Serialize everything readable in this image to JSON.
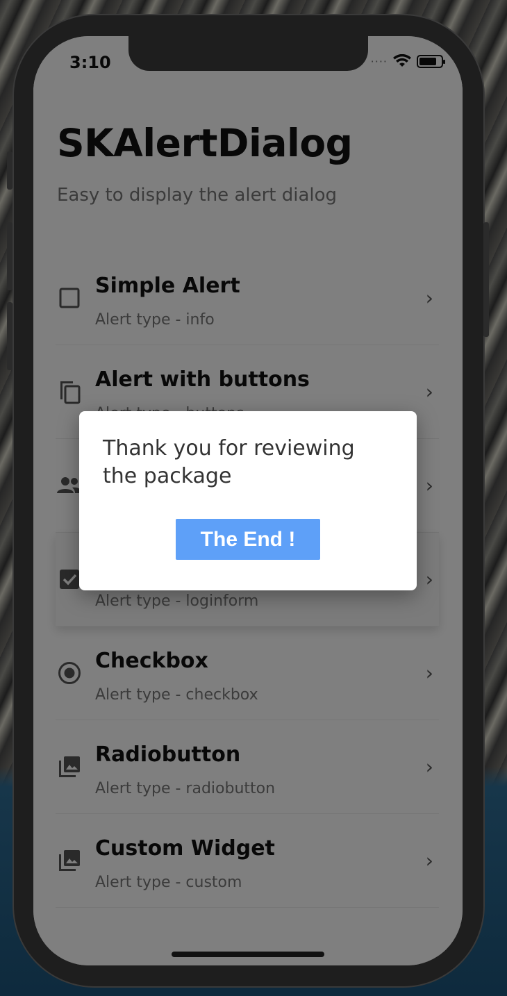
{
  "status_bar": {
    "time": "3:10"
  },
  "app": {
    "title": "SKAlertDialog",
    "subtitle": "Easy to display the alert dialog"
  },
  "list": {
    "items": [
      {
        "title": "Simple Alert",
        "subtitle": "Alert type - info",
        "icon": "square-outline-icon"
      },
      {
        "title": "Alert with buttons",
        "subtitle": "Alert type - buttons",
        "icon": "copy-icon"
      },
      {
        "title": "",
        "subtitle": "",
        "icon": "people-icon"
      },
      {
        "title": "",
        "subtitle": "Alert type - loginform",
        "icon": "checkbox-checked-icon"
      },
      {
        "title": "Checkbox",
        "subtitle": "Alert type - checkbox",
        "icon": "radio-checked-icon"
      },
      {
        "title": "Radiobutton",
        "subtitle": "Alert type - radiobutton",
        "icon": "photo-library-icon"
      },
      {
        "title": "Custom Widget",
        "subtitle": "Alert type - custom",
        "icon": "photo-library-icon"
      }
    ]
  },
  "dialog": {
    "message": "Thank you for reviewing the package",
    "button_label": "The End !",
    "button_color": "#5ea0f8"
  },
  "colors": {
    "overlay": "rgba(0,0,0,0.5)",
    "title": "#111111",
    "subtitle": "#777777"
  }
}
